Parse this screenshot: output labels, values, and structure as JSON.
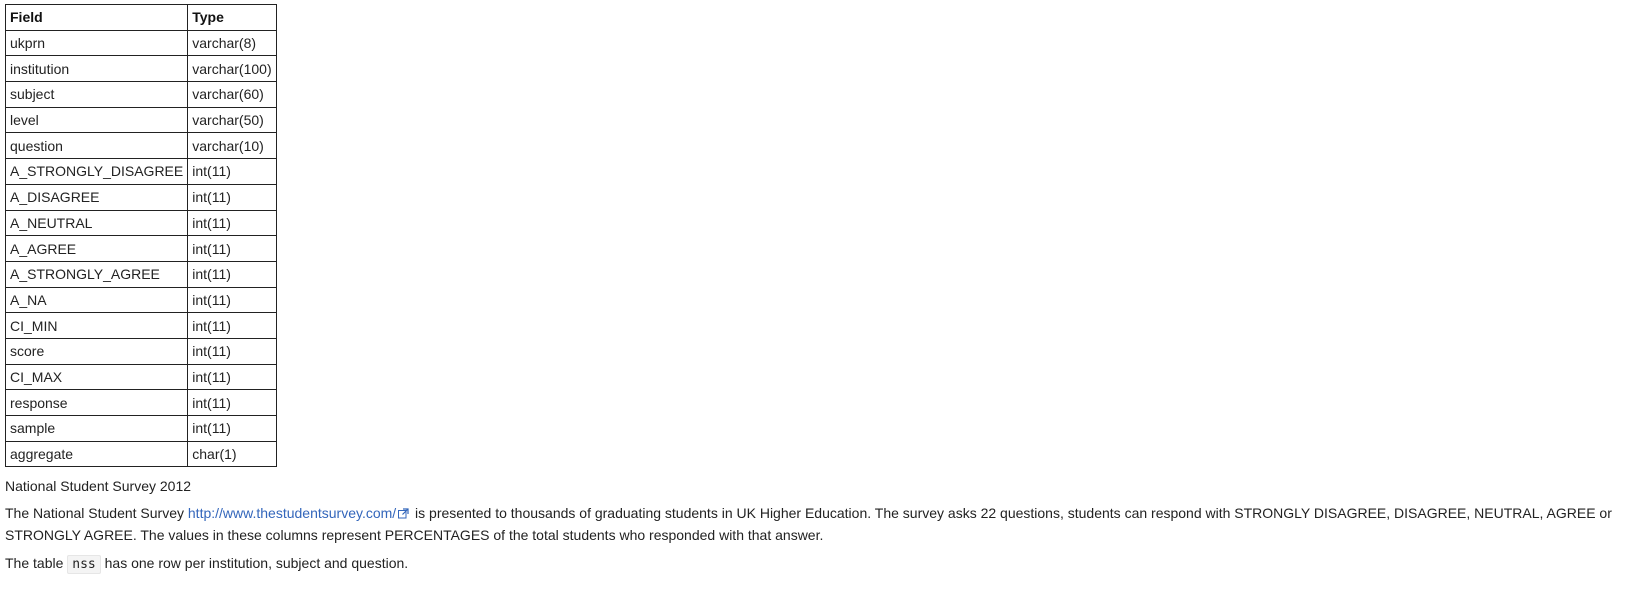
{
  "schema_table": {
    "headers": {
      "field": "Field",
      "type": "Type"
    },
    "rows": [
      {
        "field": "ukprn",
        "type": "varchar(8)"
      },
      {
        "field": "institution",
        "type": "varchar(100)"
      },
      {
        "field": "subject",
        "type": "varchar(60)"
      },
      {
        "field": "level",
        "type": "varchar(50)"
      },
      {
        "field": "question",
        "type": "varchar(10)"
      },
      {
        "field": "A_STRONGLY_DISAGREE",
        "type": "int(11)"
      },
      {
        "field": "A_DISAGREE",
        "type": "int(11)"
      },
      {
        "field": "A_NEUTRAL",
        "type": "int(11)"
      },
      {
        "field": "A_AGREE",
        "type": "int(11)"
      },
      {
        "field": "A_STRONGLY_AGREE",
        "type": "int(11)"
      },
      {
        "field": "A_NA",
        "type": "int(11)"
      },
      {
        "field": "CI_MIN",
        "type": "int(11)"
      },
      {
        "field": "score",
        "type": "int(11)"
      },
      {
        "field": "CI_MAX",
        "type": "int(11)"
      },
      {
        "field": "response",
        "type": "int(11)"
      },
      {
        "field": "sample",
        "type": "int(11)"
      },
      {
        "field": "aggregate",
        "type": "char(1)"
      }
    ]
  },
  "caption": {
    "title": "National Student Survey 2012"
  },
  "description": {
    "before_link": "The National Student Survey ",
    "link_text": "http://www.thestudentsurvey.com/",
    "after_link": " is presented to thousands of graduating students in UK Higher Education. The survey asks 22 questions, students can respond with STRONGLY DISAGREE, DISAGREE, NEUTRAL, AGREE or STRONGLY AGREE. The values in these columns represent PERCENTAGES of the total students who responded with that answer."
  },
  "table_note": {
    "before_code": "The table ",
    "code": "nss",
    "after_code": " has one row per institution, subject and question."
  },
  "icons": {
    "external_link": "external-link-icon"
  },
  "colors": {
    "link": "#3366bb",
    "text": "#222222",
    "border": "#222222"
  }
}
